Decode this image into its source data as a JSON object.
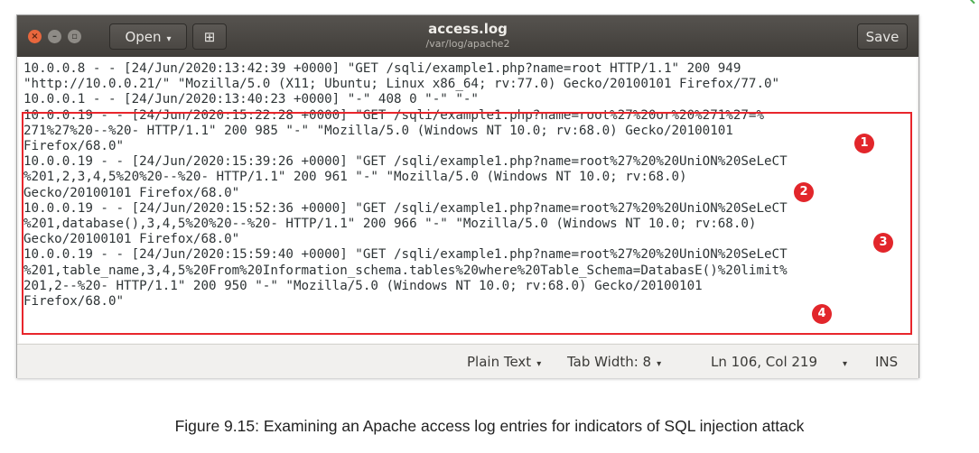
{
  "window": {
    "title": "access.log",
    "subtitle": "/var/log/apache2",
    "close_glyph": "×",
    "minimize_glyph": "–",
    "maximize_glyph": "▫",
    "open_label": "Open",
    "open_caret": "▾",
    "newtab_glyph": "⊞",
    "save_label": "Save"
  },
  "log_lines": [
    "10.0.0.8 - - [24/Jun/2020:13:42:39 +0000] \"GET /sqli/example1.php?name=root HTTP/1.1\" 200 949",
    "\"http://10.0.0.21/\" \"Mozilla/5.0 (X11; Ubuntu; Linux x86_64; rv:77.0) Gecko/20100101 Firefox/77.0\"",
    "10.0.0.1 - - [24/Jun/2020:13:40:23 +0000] \"-\" 408 0 \"-\" \"-\"",
    "10.0.0.19 - - [24/Jun/2020:15:22:28 +0000] \"GET /sqli/example1.php?name=root%27%20or%20%271%27=%",
    "271%27%20--%20- HTTP/1.1\" 200 985 \"-\" \"Mozilla/5.0 (Windows NT 10.0; rv:68.0) Gecko/20100101",
    "Firefox/68.0\"",
    "10.0.0.19 - - [24/Jun/2020:15:39:26 +0000] \"GET /sqli/example1.php?name=root%27%20%20UniON%20SeLeCT",
    "%201,2,3,4,5%20%20--%20- HTTP/1.1\" 200 961 \"-\" \"Mozilla/5.0 (Windows NT 10.0; rv:68.0)",
    "Gecko/20100101 Firefox/68.0\"",
    "10.0.0.19 - - [24/Jun/2020:15:52:36 +0000] \"GET /sqli/example1.php?name=root%27%20%20UniON%20SeLeCT",
    "%201,database(),3,4,5%20%20--%20- HTTP/1.1\" 200 966 \"-\" \"Mozilla/5.0 (Windows NT 10.0; rv:68.0)",
    "Gecko/20100101 Firefox/68.0\"",
    "10.0.0.19 - - [24/Jun/2020:15:59:40 +0000] \"GET /sqli/example1.php?name=root%27%20%20UniON%20SeLeCT",
    "%201,table_name,3,4,5%20From%20Information_schema.tables%20where%20Table_Schema=DatabasE()%20limit%",
    "201,2--%20- HTTP/1.1\" 200 950 \"-\" \"Mozilla/5.0 (Windows NT 10.0; rv:68.0) Gecko/20100101",
    "Firefox/68.0\""
  ],
  "markers": [
    "1",
    "2",
    "3",
    "4"
  ],
  "statusbar": {
    "syntax": "Plain Text",
    "tab_width": "Tab Width: 8",
    "position": "Ln 106, Col 219",
    "mode": "INS",
    "caret": "▾"
  },
  "caption": "Figure 9.15: Examining an Apache access log entries for indicators of SQL injection attack",
  "colors": {
    "highlight": "#e8262c",
    "titlebar": "#403d39",
    "close_button": "#e9673d"
  }
}
